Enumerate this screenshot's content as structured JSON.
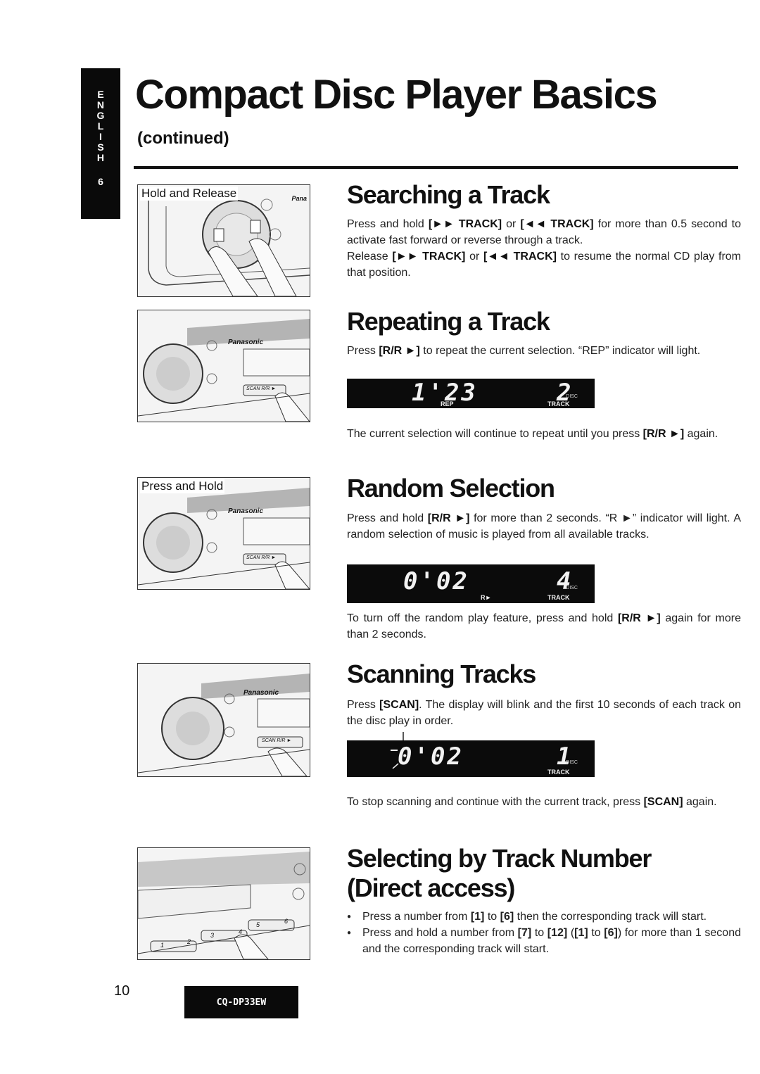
{
  "side_tab": {
    "letters": [
      "E",
      "N",
      "G",
      "L",
      "I",
      "S",
      "H"
    ],
    "number": "6"
  },
  "header": {
    "title": "Compact Disc Player Basics",
    "subtitle": "(continued)"
  },
  "illustrations": [
    {
      "caption": "Hold and Release",
      "brand": "Pana"
    },
    {
      "caption": "",
      "brand": "Panasonic",
      "button": "SCAN R/R ►"
    },
    {
      "caption": "Press and Hold",
      "brand": "Panasonic",
      "button": "SCAN R/R ►"
    },
    {
      "caption": "",
      "brand": "Panasonic",
      "button": "SCAN R/R ►"
    },
    {
      "caption": "",
      "preset_buttons": [
        "1",
        "2",
        "3",
        "4",
        "5",
        "6"
      ]
    }
  ],
  "sections": {
    "searching": {
      "heading": "Searching a Track",
      "p1_a": "Press and hold ",
      "p1_b1": "[►► TRACK]",
      "p1_c": " or ",
      "p1_b2": "[◄◄ TRACK]",
      "p1_d": " for more than 0.5 second to activate fast forward or reverse through a track.",
      "p2_a": "Release ",
      "p2_b1": "[►► TRACK]",
      "p2_c": " or ",
      "p2_b2": "[◄◄ TRACK]",
      "p2_d": " to resume the normal CD play from that position."
    },
    "repeating": {
      "heading": "Repeating a Track",
      "p1_a": "Press ",
      "p1_b": "[R/R ►]",
      "p1_c": " to repeat the current selection. “REP” indicator will light.",
      "display": {
        "time": "1'23",
        "indicator": "REP",
        "track": "2",
        "track_label": "TRACK",
        "disc_label": "DISC"
      },
      "p2_a": "The current selection will continue to repeat until you press ",
      "p2_b": "[R/R ►]",
      "p2_c": " again."
    },
    "random": {
      "heading": "Random Selection",
      "p1_a": "Press and hold ",
      "p1_b": "[R/R ►]",
      "p1_c": " for more than 2 seconds. “R ►” indicator will light. A random selection of music is played from all available tracks.",
      "display": {
        "time": "0'02",
        "indicator": "R►",
        "track": "4",
        "track_label": "TRACK",
        "disc_label": "DISC"
      },
      "p2_a": "To turn off the random play feature, press and hold ",
      "p2_b": "[R/R ►]",
      "p2_c": " again for more than 2 seconds."
    },
    "scanning": {
      "heading": "Scanning Tracks",
      "p1_a": "Press ",
      "p1_b": "[SCAN]",
      "p1_c": ". The display will blink and the first 10 seconds of each track on the disc play in order.",
      "display": {
        "time": "0'02",
        "track": "1",
        "track_label": "TRACK",
        "disc_label": "DISC"
      },
      "p2_a": "To stop scanning and continue with the current track, press ",
      "p2_b": "[SCAN]",
      "p2_c": " again."
    },
    "direct": {
      "heading_line1": "Selecting by Track Number",
      "heading_line2": "(Direct access)",
      "bullet1_a": "Press a number from ",
      "bullet1_b1": "[1]",
      "bullet1_c": " to ",
      "bullet1_b2": "[6]",
      "bullet1_d": " then the corresponding track will start.",
      "bullet2_a": "Press and hold a number from ",
      "bullet2_b1": "[7]",
      "bullet2_c": " to ",
      "bullet2_b2": "[12]",
      "bullet2_d": " (",
      "bullet2_b3": "[1]",
      "bullet2_e": " to ",
      "bullet2_b4": "[6]",
      "bullet2_f": ") for more than 1 second and the corresponding track will start."
    }
  },
  "footer": {
    "page_number": "10",
    "model": "CQ-DP33EW"
  }
}
